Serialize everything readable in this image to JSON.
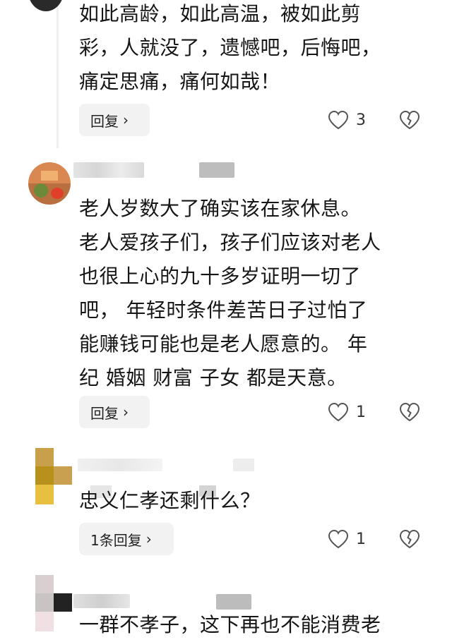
{
  "comments": [
    {
      "text_lines": [
        "如此高龄，如此高温，被如此剪",
        "彩，人就没了，遗憾吧，后悔吧，",
        "痛定思痛，痛何如哉！"
      ],
      "reply_label": "回复",
      "likes": "3"
    },
    {
      "text_lines": [
        "老人岁数大了确实该在家休息。",
        "老人爱孩子们，孩子们应该对老人",
        "也很上心的九十多岁证明一切了",
        "吧， 年轻时条件差苦日子过怕了",
        "能赚钱可能也是老人愿意的。 年",
        "纪 婚姻 财富 子女 都是天意。"
      ],
      "reply_label": "回复",
      "likes": "1"
    },
    {
      "text_lines": [
        "忠义仁孝还剩什么？"
      ],
      "reply_label": "1条回复",
      "likes": "1"
    },
    {
      "text_lines": [
        "一群不孝子，这下再也不能消费老"
      ]
    }
  ],
  "watermark": "…能消费老",
  "icons": {
    "like": "heart-outline-icon",
    "dislike": "broken-heart-icon",
    "chevron": "chevron-right-icon"
  },
  "colors": {
    "text": "#161616",
    "reply_bg": "#f2f2f2",
    "icon": "#555555"
  }
}
